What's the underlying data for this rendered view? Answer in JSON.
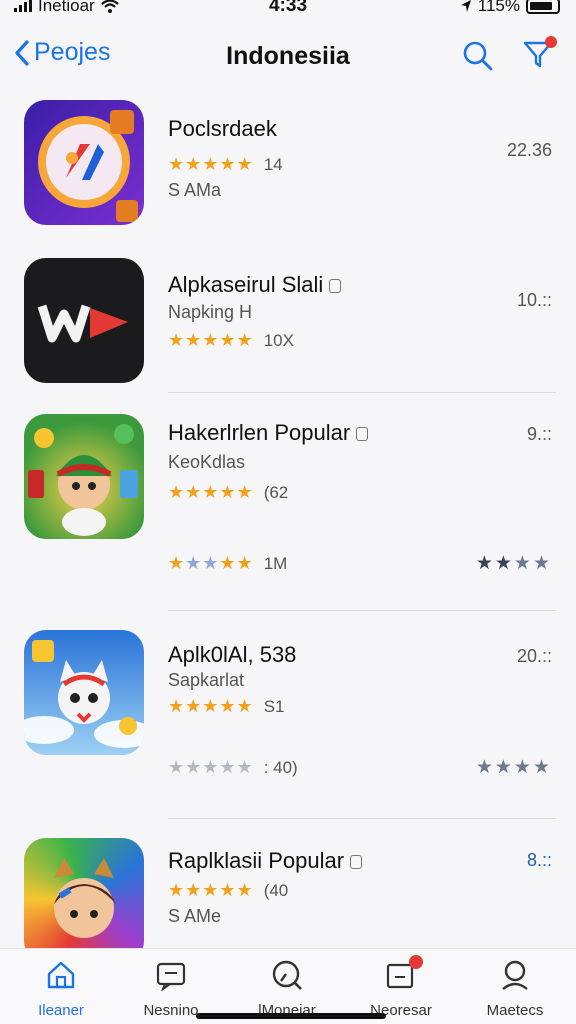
{
  "status_bar": {
    "carrier": "Inetioar",
    "time": "4:33",
    "battery": "115%"
  },
  "nav": {
    "back_label": "Peojes",
    "title": "Indonesiia"
  },
  "apps": [
    {
      "name": "Poclsrdaek",
      "stars": "★★★★★",
      "rating_count": "14",
      "subtitle": "S AMa",
      "price": "22.36"
    },
    {
      "name": "Alpkaseirul Slali",
      "subtitle": "Napking H",
      "stars": "★★★★★",
      "rating_count": "10X",
      "price": "10.::"
    },
    {
      "name": "Hakerlrlen Popular",
      "subtitle": "KeoKdlas",
      "stars": "★★★★★",
      "rating_count": "(62",
      "price": "9.::",
      "extra_rating": {
        "stars": "★★★★★",
        "count": "1M",
        "right_stars": "★★★★"
      }
    },
    {
      "name": "Aplk0lAl, 538",
      "subtitle": "Sapkarlat",
      "stars": "★★★★★",
      "rating_count": "S1",
      "price": "20.::",
      "extra_rating": {
        "stars": "★★★★★",
        "count": ": 40)",
        "right_stars": "★★★★"
      }
    },
    {
      "name": "Raplklasii Popular",
      "stars": "★★★★★",
      "rating_count": "(40",
      "subtitle": "S AMe",
      "price": "8.::"
    }
  ],
  "tabs": [
    {
      "label": "Ileaner",
      "icon": "home-icon",
      "active": true
    },
    {
      "label": "Nesnino",
      "icon": "message-icon"
    },
    {
      "label": "lMoneiar",
      "icon": "search-icon"
    },
    {
      "label": "Neoresar",
      "icon": "notifications-icon"
    },
    {
      "label": "Maetecs",
      "icon": "profile-icon"
    }
  ],
  "colors": {
    "accent": "#1a73e8",
    "star": "#f2a11c",
    "badge": "#e53935"
  }
}
